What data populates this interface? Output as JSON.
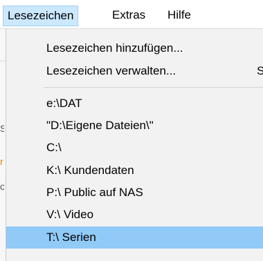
{
  "menubar": {
    "items": [
      {
        "label": "Lesezeichen",
        "open": true
      },
      {
        "label": "Extras"
      },
      {
        "label": "Hilfe"
      }
    ]
  },
  "dropdown": {
    "actions": [
      {
        "label": "Lesezeichen hinzufügen...",
        "shortcut": ""
      },
      {
        "label": "Lesezeichen verwalten...",
        "shortcut": "S"
      }
    ],
    "bookmarks": [
      {
        "label": "e:\\DAT"
      },
      {
        "label": "\"D:\\Eigene Dateien\\\""
      },
      {
        "label": "C:\\"
      },
      {
        "label": "K:\\ Kundendaten"
      },
      {
        "label": "P:\\  Public auf NAS"
      },
      {
        "label": "V:\\ Video"
      },
      {
        "label": "T:\\ Serien",
        "highlighted": true
      }
    ]
  },
  "background": {
    "hint_chars": [
      "S",
      "r",
      "o"
    ]
  }
}
